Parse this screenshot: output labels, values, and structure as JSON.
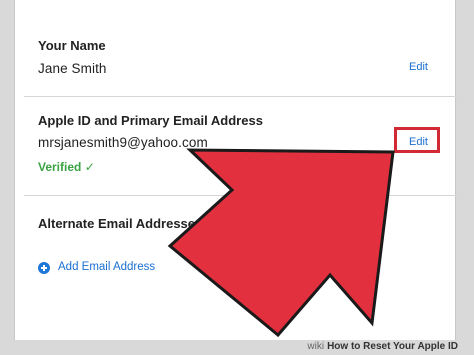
{
  "profile": {
    "name_section": {
      "title": "Your Name",
      "value": "Jane Smith",
      "edit_label": "Edit"
    },
    "apple_id_section": {
      "title": "Apple ID and Primary Email Address",
      "value": "mrsjanesmith9@yahoo.com",
      "edit_label": "Edit",
      "status": "Verified ✓"
    },
    "alternate_section": {
      "title": "Alternate Email Addresses",
      "add_label": "Add Email Address"
    }
  },
  "watermark": {
    "brand": "wiki",
    "text": "How to Reset Your Apple ID"
  },
  "colors": {
    "accent": "#1a6fd1",
    "verified": "#3aa343",
    "arrow": "#e2303e",
    "highlight": "#d22a35"
  }
}
